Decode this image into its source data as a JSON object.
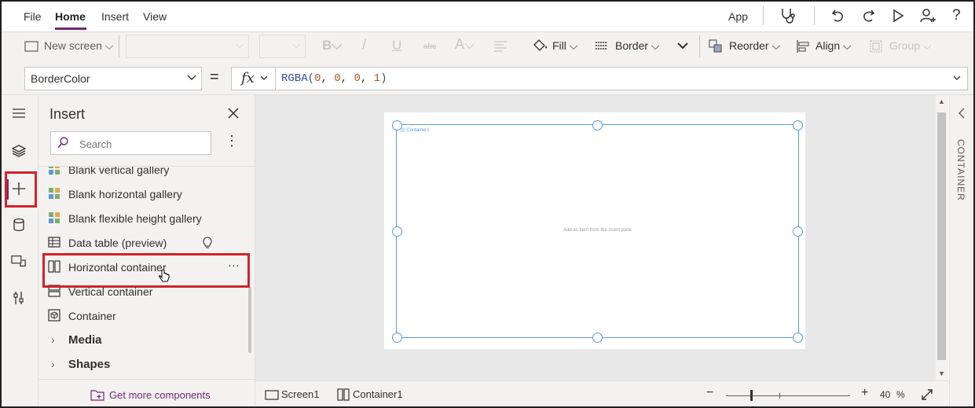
{
  "menubar": {
    "tabs": [
      {
        "label": "File"
      },
      {
        "label": "Home"
      },
      {
        "label": "Insert"
      },
      {
        "label": "View"
      }
    ],
    "app_label": "App",
    "icons": [
      "stethoscope-icon",
      "undo-icon",
      "redo-icon",
      "play-icon",
      "person-add-icon",
      "help-icon"
    ]
  },
  "ribbon": {
    "new_screen": "New screen",
    "bold": "B",
    "italic": "/",
    "underline": "U",
    "strike": "abc",
    "font_color": "A",
    "fill": "Fill",
    "border": "Border",
    "reorder": "Reorder",
    "align": "Align",
    "group": "Group"
  },
  "formula_bar": {
    "property": "BorderColor",
    "equals": "=",
    "fx": "fx",
    "formula": {
      "fn": "RGBA(",
      "args": [
        "0",
        "0",
        "0",
        "1"
      ],
      "close": ")"
    }
  },
  "insert_pane": {
    "title": "Insert",
    "search_placeholder": "Search",
    "items": [
      {
        "label": "Blank vertical gallery"
      },
      {
        "label": "Blank horizontal gallery"
      },
      {
        "label": "Blank flexible height gallery"
      },
      {
        "label": "Data table (preview)"
      },
      {
        "label": "Horizontal container",
        "more": "···"
      },
      {
        "label": "Vertical container"
      },
      {
        "label": "Container"
      }
    ],
    "groups": [
      {
        "label": "Media"
      },
      {
        "label": "Shapes"
      }
    ],
    "get_more": "Get more components"
  },
  "canvas": {
    "container_label": "Container1",
    "hint": "Add an item from the insert pane"
  },
  "right_panel": {
    "label": "CONTAINER"
  },
  "status_bar": {
    "screen": "Screen1",
    "container": "Container1",
    "zoom_minus": "−",
    "zoom_plus": "+",
    "zoom_value": "40",
    "zoom_unit": "%"
  },
  "colors": {
    "accent": "#742774",
    "selection": "#5b9bd5",
    "highlight": "#d1232a"
  }
}
